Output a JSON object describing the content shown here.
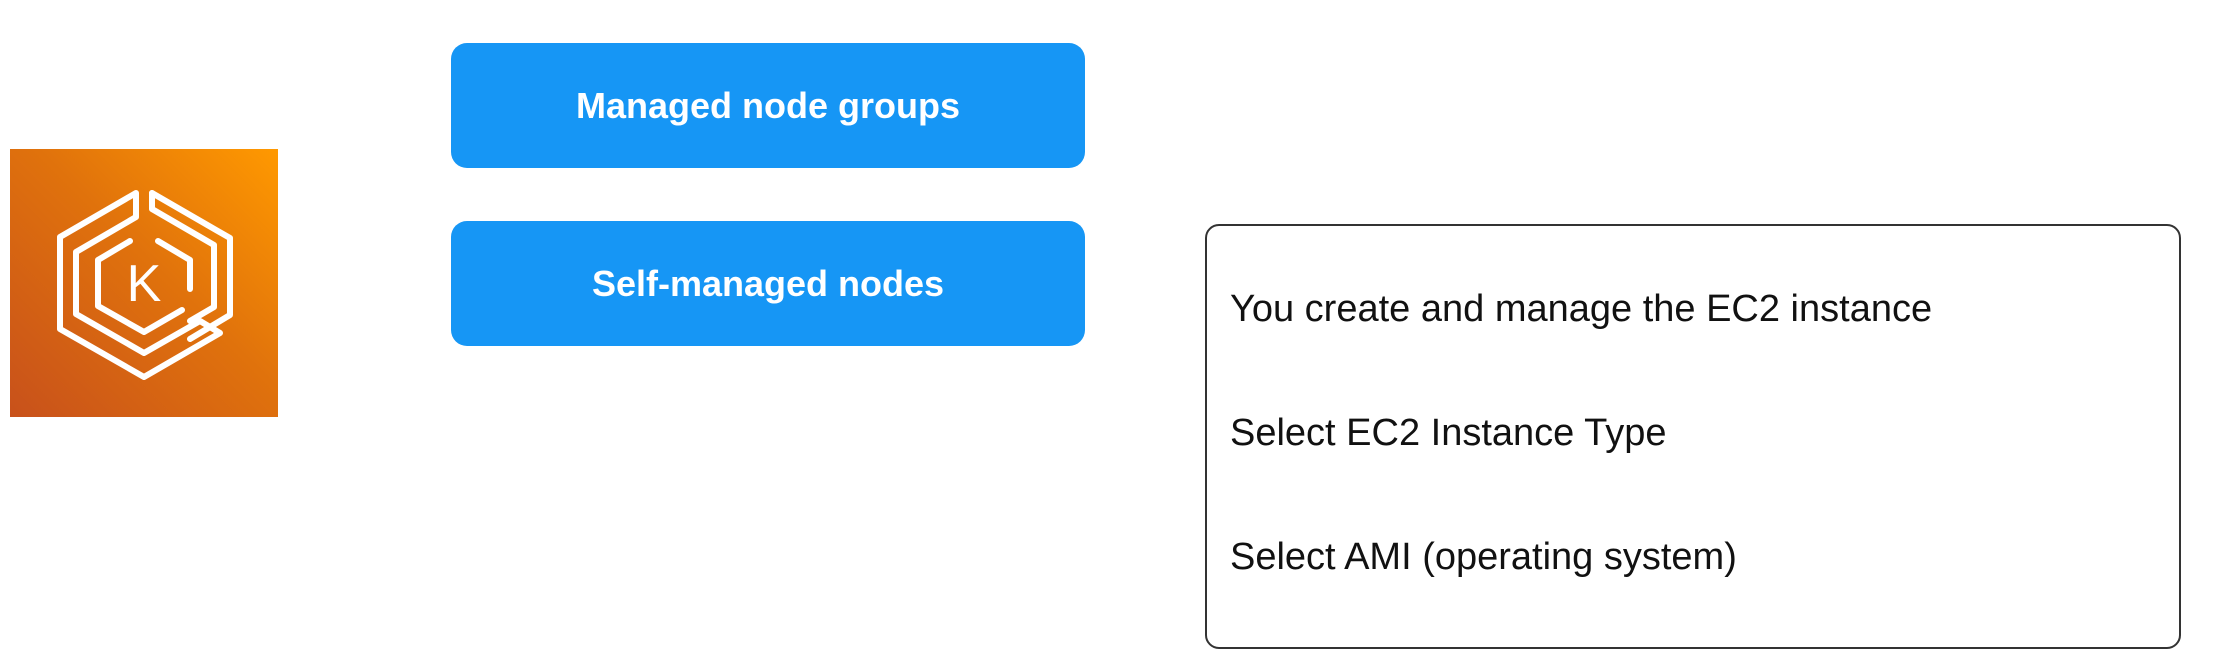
{
  "logo": {
    "icon": "amazon-eks-icon",
    "letter": "K",
    "colors": {
      "gradient_start": "#c8511b",
      "gradient_end": "#ff9900",
      "stroke": "#ffffff"
    }
  },
  "options": {
    "managed_label": "Managed node groups",
    "self_managed_label": "Self-managed nodes",
    "button_color": "#1696f5"
  },
  "info_box": {
    "lines": [
      "You create and manage the EC2 instance",
      "Select EC2 Instance Type",
      "Select AMI (operating system)"
    ]
  }
}
